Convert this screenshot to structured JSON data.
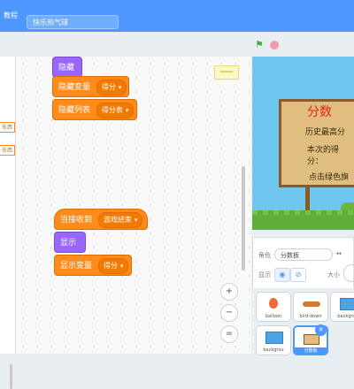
{
  "menubar": {
    "tutorials_label": "教程",
    "project_title": "快乐热气球"
  },
  "left_panel": {
    "chip1": "东西",
    "chip2": "东西"
  },
  "scripts": {
    "group1": {
      "hide": "隐藏",
      "hide_variable": {
        "label": "隐藏变量",
        "value": "得分"
      },
      "hide_list": {
        "label": "隐藏列表",
        "value": "得分表"
      }
    },
    "group2": {
      "when_receive": {
        "label": "当接收到",
        "value": "游戏结束"
      },
      "show": "显示",
      "show_variable": {
        "label": "显示变量",
        "value": "得分"
      }
    }
  },
  "zoom": {
    "in": "+",
    "out": "−",
    "reset": "="
  },
  "stage": {
    "board_title": "分数",
    "line1": "历史最高分",
    "line2": "本次的得分：",
    "line3": "点击绿色旗"
  },
  "sprite_info": {
    "sprite_label": "角色",
    "sprite_name": "分数板",
    "show_label": "显示",
    "size_label": "大小"
  },
  "sprites": [
    {
      "name": "balloon",
      "icon": "balloon-icon"
    },
    {
      "name": "bird-down",
      "icon": "bird-icon"
    },
    {
      "name": "backgrou",
      "icon": "background-icon"
    },
    {
      "name": "backgrou",
      "icon": "background-icon"
    },
    {
      "name": "分数板",
      "icon": "scoreboard-icon",
      "selected": true
    }
  ],
  "colors": {
    "accent": "#4d97ff",
    "variables": "#ff8c1a",
    "looks": "#9966ff"
  }
}
